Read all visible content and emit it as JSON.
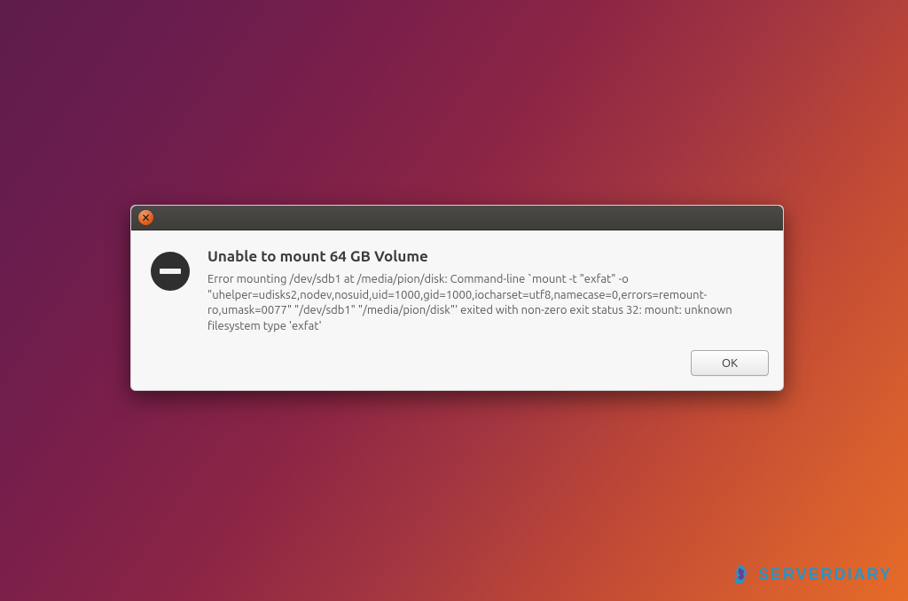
{
  "dialog": {
    "title": "Unable to mount 64 GB Volume",
    "message": "Error mounting /dev/sdb1 at /media/pion/disk: Command-line `mount -t \"exfat\" -o \"uhelper=udisks2,nodev,nosuid,uid=1000,gid=1000,iocharset=utf8,namecase=0,errors=remount-ro,umask=0077\" \"/dev/sdb1\" \"/media/pion/disk\"' exited with non-zero exit status 32: mount: unknown filesystem type 'exfat'",
    "ok_label": "OK"
  },
  "watermark": {
    "text": "SERVERDIARY"
  },
  "colors": {
    "error_icon_bg": "#2f2f2f",
    "error_icon_bar": "#f2f2f2",
    "close_btn": "#e05f1d",
    "accent": "#1b98d0"
  }
}
